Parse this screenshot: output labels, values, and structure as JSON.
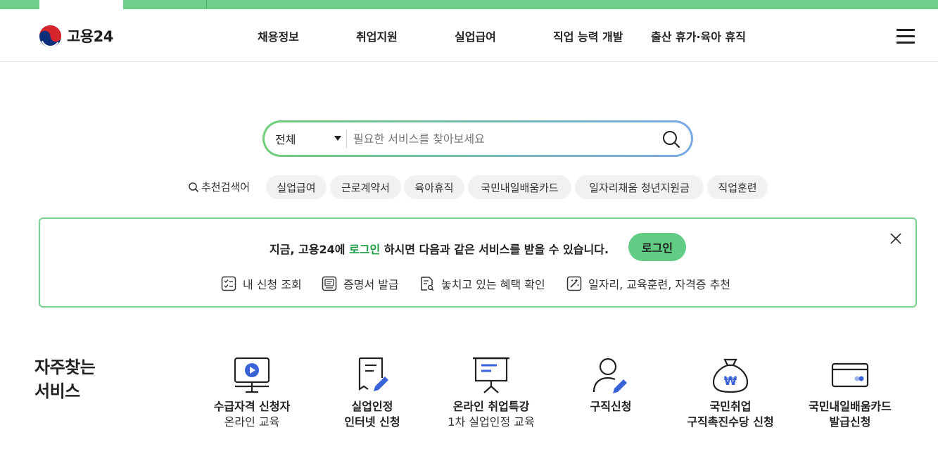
{
  "brand": {
    "name": "고용24"
  },
  "nav": {
    "items": [
      "채용정보",
      "취업지원",
      "실업급여",
      "직업 능력 개발",
      "출산 휴가·육아 휴직"
    ]
  },
  "search": {
    "category": "전체",
    "placeholder": "필요한 서비스를 찾아보세요",
    "value": ""
  },
  "recommended": {
    "label": "추천검색어",
    "keywords": [
      "실업급여",
      "근로계약서",
      "육아휴직",
      "국민내일배움카드",
      "일자리채움 청년지원금",
      "직업훈련"
    ]
  },
  "banner": {
    "msg_prefix": "지금, 고용24에 ",
    "msg_highlight": "로그인",
    "msg_suffix": " 하시면 다음과 같은 서비스를 받을 수 있습니다.",
    "login_label": "로그인",
    "benefits": [
      "내 신청 조회",
      "증명서 발급",
      "놓치고 있는 혜택 확인",
      "일자리, 교육훈련, 자격증 추천"
    ]
  },
  "frequent": {
    "title_line1": "자주찾는",
    "title_line2": "서비스",
    "items": [
      {
        "line1": "수급자격 신청자",
        "line2": "온라인 교육"
      },
      {
        "line1": "실업인정",
        "line2": "인터넷 신청"
      },
      {
        "line1": "온라인 취업특강",
        "line2": "1차 실업인정 교육"
      },
      {
        "line1": "구직신청",
        "line2": ""
      },
      {
        "line1": "국민취업",
        "line2": "구직촉진수당 신청"
      },
      {
        "line1": "국민내일배움카드",
        "line2": "발급신청"
      }
    ]
  },
  "colors": {
    "accent_green": "#62cc84",
    "highlight_green": "#1f9d46",
    "icon_blue": "#3a63d8"
  }
}
